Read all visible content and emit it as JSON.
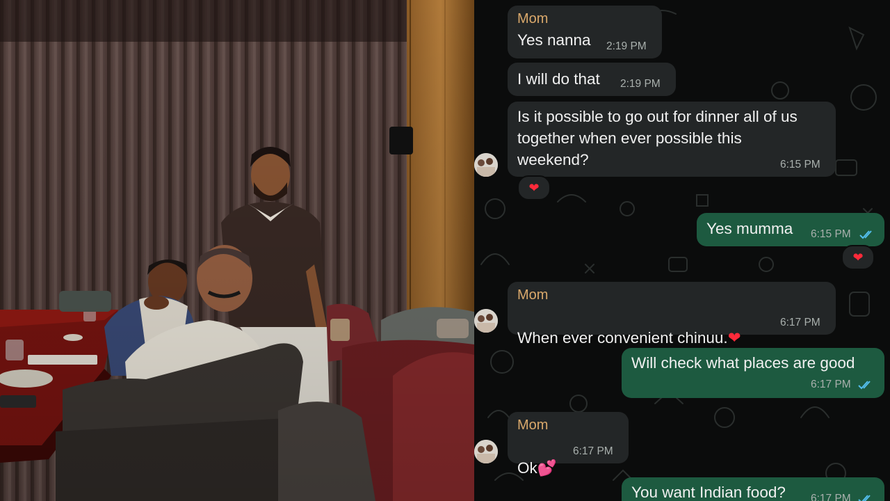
{
  "chat": {
    "messages": [
      {
        "sender": "Mom",
        "text": "Yes nanna",
        "time": "2:19 PM"
      },
      {
        "text": "I will do that",
        "time": "2:19 PM"
      },
      {
        "text": "Is it possible to go out for dinner all of us\ntogether when ever possible this\nweekend?",
        "time": "6:15 PM",
        "reaction": "❤"
      },
      {
        "text": "Yes mumma",
        "time": "6:15 PM",
        "reaction": "❤"
      },
      {
        "sender": "Mom",
        "text": "When ever convenient chinuu.",
        "emoji": "❤",
        "time": "6:17 PM"
      },
      {
        "text": "Will check what places are good",
        "time": "6:17 PM"
      },
      {
        "sender": "Mom",
        "text": "Ok",
        "emoji": "💕",
        "time": "6:17 PM"
      },
      {
        "text": "You want Indian food?",
        "time": "6:17 PM"
      }
    ]
  },
  "colors": {
    "incoming_bubble": "#232627",
    "outgoing_bubble": "#1d5a40",
    "sender_name": "#d9a86b",
    "read_ticks": "#53bdeb",
    "chat_background": "#0b0c0c"
  },
  "icons": [
    "double-check-icon",
    "heart-emoji",
    "two-hearts-emoji",
    "contact-avatar"
  ]
}
